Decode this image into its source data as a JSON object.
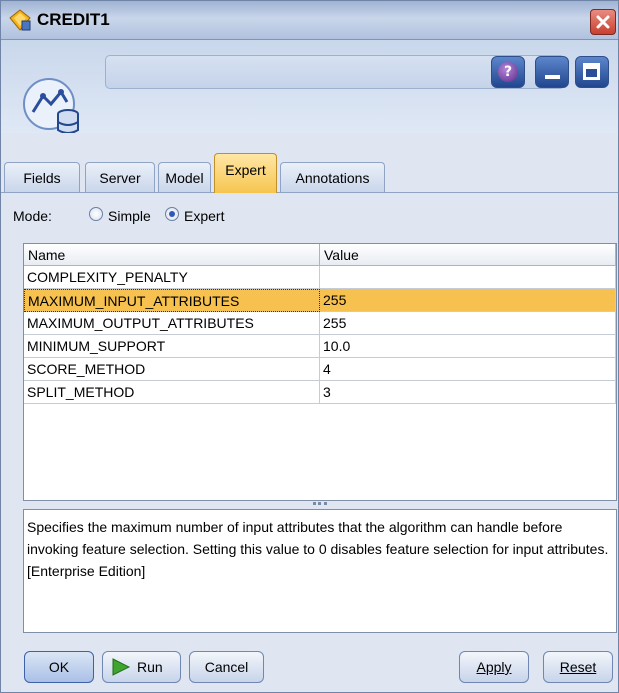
{
  "window": {
    "title": "CREDIT1"
  },
  "header": {
    "node_name_value": ""
  },
  "tabs": [
    {
      "label": "Fields",
      "active": false
    },
    {
      "label": "Server",
      "active": false
    },
    {
      "label": "Model",
      "active": false
    },
    {
      "label": "Expert",
      "active": true
    },
    {
      "label": "Annotations",
      "active": false
    }
  ],
  "mode": {
    "label": "Mode:",
    "options": [
      {
        "label": "Simple",
        "checked": false
      },
      {
        "label": "Expert",
        "checked": true
      }
    ]
  },
  "table": {
    "columns": [
      "Name",
      "Value"
    ],
    "rows": [
      {
        "name": "COMPLEXITY_PENALTY",
        "value": ""
      },
      {
        "name": "MAXIMUM_INPUT_ATTRIBUTES",
        "value": "255",
        "selected": true
      },
      {
        "name": "MAXIMUM_OUTPUT_ATTRIBUTES",
        "value": "255"
      },
      {
        "name": "MINIMUM_SUPPORT",
        "value": "10.0"
      },
      {
        "name": "SCORE_METHOD",
        "value": "4"
      },
      {
        "name": "SPLIT_METHOD",
        "value": "3"
      }
    ]
  },
  "description": "Specifies the maximum number of input attributes that the algorithm can handle before invoking feature selection. Setting this value to 0 disables feature selection for input attributes. [Enterprise Edition]",
  "footer": {
    "ok_label": "OK",
    "run_label": "Run",
    "cancel_label": "Cancel",
    "apply_label": "Apply",
    "reset_label": "Reset"
  },
  "icons": {
    "title": "node-diamond-icon",
    "node": "tree-database-icon",
    "help": "help-icon",
    "minimize": "minimize-icon",
    "maximize": "maximize-icon",
    "close": "close-icon",
    "run": "play-icon"
  },
  "colors": {
    "selection": "#f6c14f",
    "active_tab": "#f6c54e",
    "close": "#c8402f"
  }
}
